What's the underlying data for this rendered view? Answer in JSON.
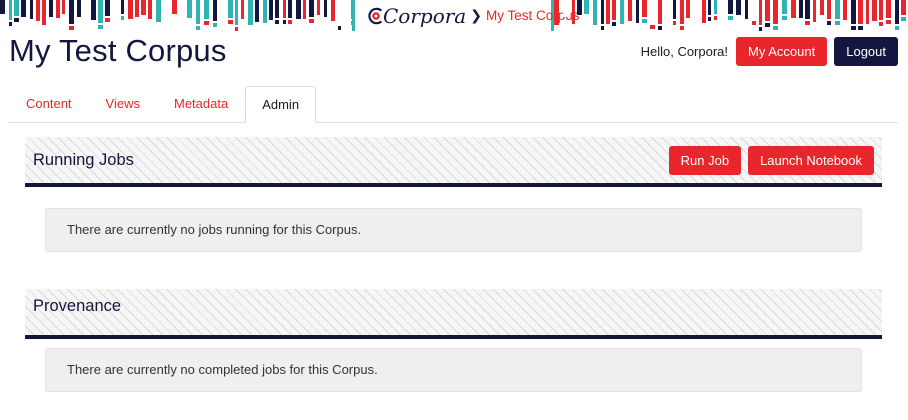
{
  "banner": {
    "logo_text": "Corpora",
    "crumb": "My Test Corpus"
  },
  "header": {
    "title": "My Test Corpus",
    "greeting": "Hello, Corpora!",
    "my_account_label": "My Account",
    "logout_label": "Logout"
  },
  "tabs": [
    {
      "label": "Content"
    },
    {
      "label": "Views"
    },
    {
      "label": "Metadata"
    },
    {
      "label": "Admin"
    }
  ],
  "running_jobs": {
    "title": "Running Jobs",
    "run_job_label": "Run Job",
    "launch_notebook_label": "Launch Notebook",
    "empty_message": "There are currently no jobs running for this Corpus."
  },
  "provenance": {
    "title": "Provenance",
    "empty_message": "There are currently no completed jobs for this Corpus."
  },
  "colors": {
    "brand_red": "#e8262b",
    "brand_navy": "#13163f",
    "brand_teal": "#2fb3b3"
  },
  "icons": {
    "logo": "corpora-logo-icon",
    "crumb_separator": "chevron-right-icon"
  }
}
